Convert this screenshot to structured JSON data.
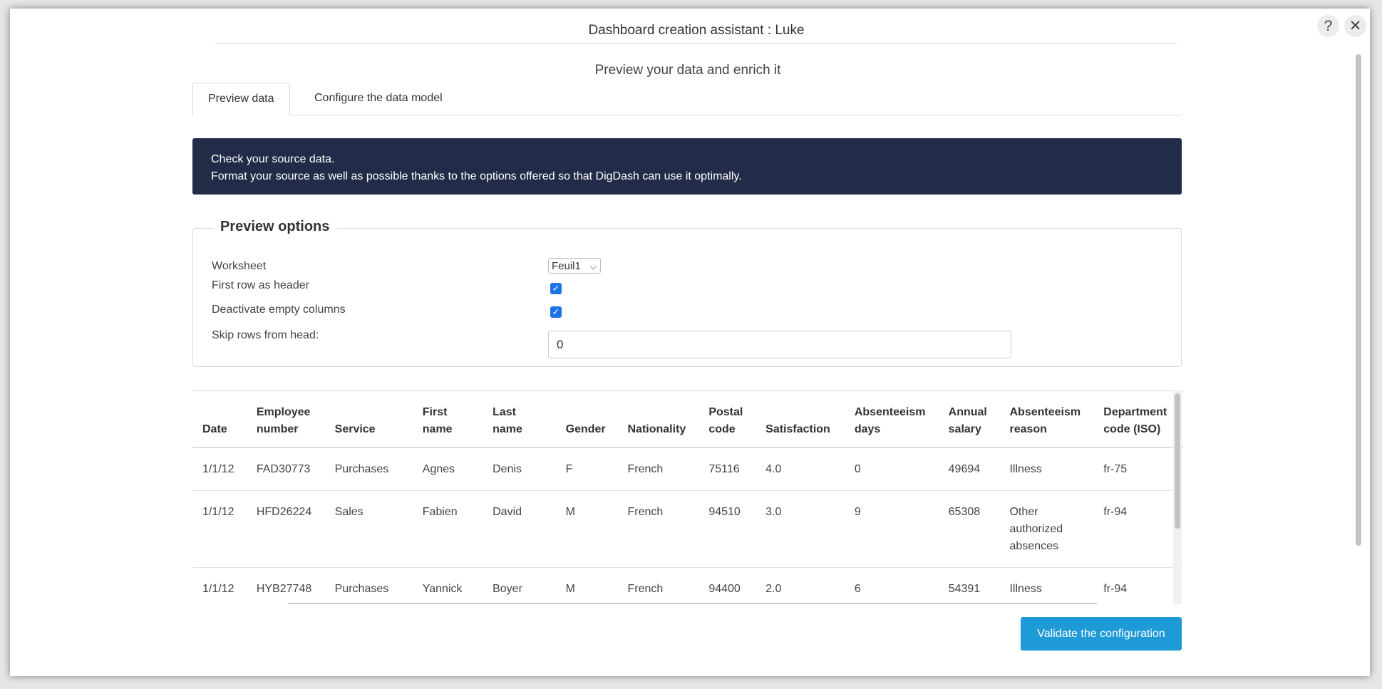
{
  "dialog": {
    "title": "Dashboard creation assistant : Luke",
    "help_icon": "?",
    "close_icon": "✕"
  },
  "subtitle": "Preview your data and enrich it",
  "tabs": [
    {
      "label": "Preview data",
      "active": true
    },
    {
      "label": "Configure the data model",
      "active": false
    }
  ],
  "banner": {
    "line1": "Check your source data.",
    "line2": "Format your source as well as possible thanks to the options offered so that DigDash can use it optimally."
  },
  "preview_options": {
    "legend": "Preview options",
    "worksheet_label": "Worksheet",
    "worksheet_value": "Feuil1",
    "first_row_header_label": "First row as header",
    "first_row_header_checked": true,
    "deactivate_empty_label": "Deactivate empty columns",
    "deactivate_empty_checked": true,
    "skip_rows_label": "Skip rows from head:",
    "skip_rows_value": "0"
  },
  "table": {
    "headers": [
      [
        "Date"
      ],
      [
        "Employee",
        "number"
      ],
      [
        "Service"
      ],
      [
        "First",
        "name"
      ],
      [
        "Last",
        "name"
      ],
      [
        "Gender"
      ],
      [
        "Nationality"
      ],
      [
        "Postal",
        "code"
      ],
      [
        "Satisfaction"
      ],
      [
        "Absenteeism",
        "days"
      ],
      [
        "Annual",
        "salary"
      ],
      [
        "Absenteeism",
        "reason"
      ],
      [
        "Department",
        "code (ISO)"
      ]
    ],
    "rows": [
      [
        "1/1/12",
        "FAD30773",
        "Purchases",
        "Agnes",
        "Denis",
        "F",
        "French",
        "75116",
        "4.0",
        "0",
        "49694",
        "Illness",
        "fr-75"
      ],
      [
        "1/1/12",
        "HFD26224",
        "Sales",
        "Fabien",
        "David",
        "M",
        "French",
        "94510",
        "3.0",
        "9",
        "65308",
        "Other authorized absences",
        "fr-94"
      ],
      [
        "1/1/12",
        "HYB27748",
        "Purchases",
        "Yannick",
        "Boyer",
        "M",
        "French",
        "94400",
        "2.0",
        "6",
        "54391",
        "Illness",
        "fr-94"
      ]
    ]
  },
  "footer": {
    "validate_label": "Validate the configuration"
  },
  "colors": {
    "banner_bg": "#222c48",
    "accent": "#1e9ad6",
    "checkbox": "#1a73e8"
  }
}
